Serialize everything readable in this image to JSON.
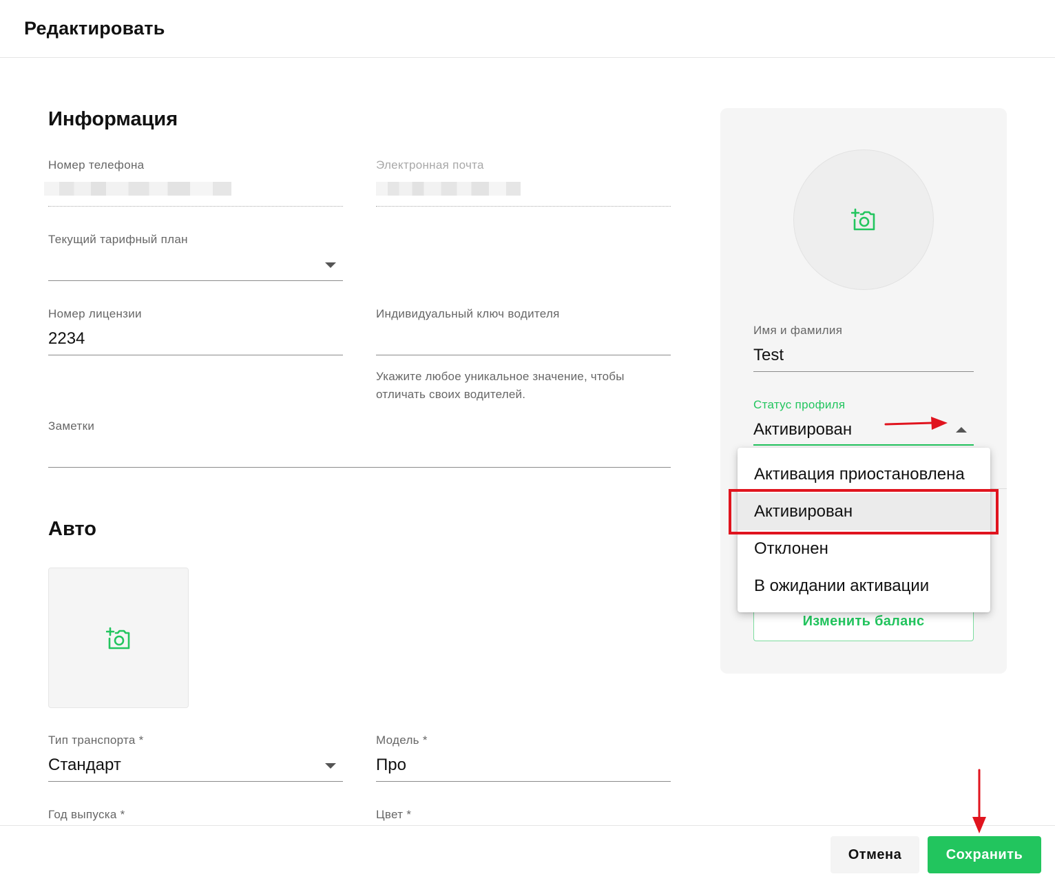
{
  "header": {
    "title": "Редактировать"
  },
  "info": {
    "section_title": "Информация",
    "phone": {
      "label": "Номер телефона"
    },
    "email": {
      "label": "Электронная почта"
    },
    "tariff": {
      "label": "Текущий тарифный план",
      "value": ""
    },
    "license": {
      "label": "Номер лицензии",
      "value": "2234"
    },
    "driver_key": {
      "label": "Индивидуальный ключ водителя",
      "value": "",
      "helper": "Укажите любое уникальное значение, чтобы отличать своих водителей."
    },
    "notes": {
      "label": "Заметки",
      "value": ""
    }
  },
  "auto": {
    "section_title": "Авто",
    "transport_type": {
      "label": "Тип транспорта *",
      "value": "Стандарт"
    },
    "model": {
      "label": "Модель *",
      "value": "Про"
    },
    "year": {
      "label": "Год выпуска *"
    },
    "color": {
      "label": "Цвет *"
    }
  },
  "profile": {
    "name": {
      "label": "Имя и фамилия",
      "value": "Test"
    },
    "status": {
      "label": "Статус профиля",
      "value": "Активирован",
      "options": [
        "Активация приостановлена",
        "Активирован",
        "Отклонен",
        "В ожидании активации"
      ],
      "selected_index": 1
    },
    "change_balance_label": "Изменить баланс"
  },
  "footer": {
    "cancel_label": "Отмена",
    "save_label": "Сохранить"
  },
  "colors": {
    "accent": "#22c55e",
    "annotation": "#e0141e"
  },
  "icons": {
    "photo": "add-photo-icon",
    "dropdown": "chevron-down-icon"
  }
}
